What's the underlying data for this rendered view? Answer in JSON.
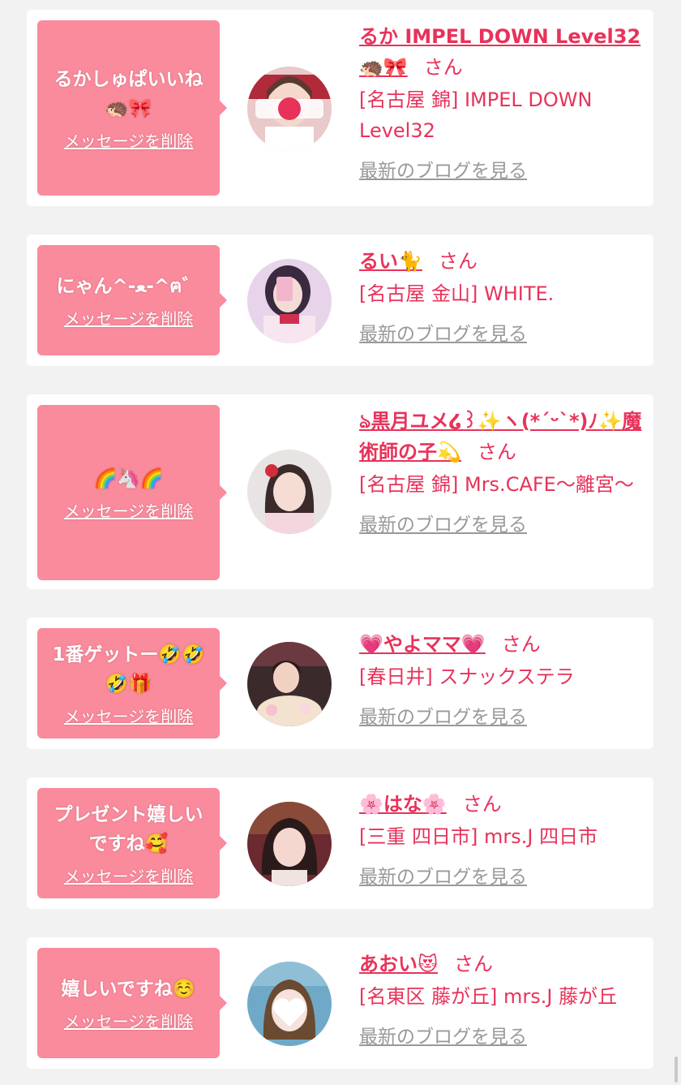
{
  "delete_label": "メッセージを削除",
  "san_label": "さん",
  "blog_label": "最新のブログを見る",
  "colors": {
    "accent": "#e8325a",
    "bubble": "#f98b9c",
    "link_gray": "#999999"
  },
  "cards": [
    {
      "message": "るかしゅぱいいね🦔🎀",
      "name": "るか IMPEL DOWN Level32🦔🎀",
      "shop": "[名古屋 錦] IMPEL DOWN Level32"
    },
    {
      "message": "にゃん^-ﻌ-^ฅ゛",
      "name": "るい🐈",
      "shop": "[名古屋 金山] WHITE."
    },
    {
      "message": "🌈🦄🌈",
      "name": "ঌ黒月ユメ໒꒱✨ヽ(*ˊᵕˋ*)ﾉ✨魔術師の子💫",
      "shop": "[名古屋 錦] Mrs.CAFE〜離宮〜"
    },
    {
      "message": "1番ゲットー🤣🤣🤣🎁",
      "name": "💗やよママ💗",
      "shop": "[春日井] スナックステラ"
    },
    {
      "message": "プレゼント嬉しいですね🥰",
      "name": "🌸はな🌸",
      "shop": "[三重 四日市] mrs.J 四日市"
    },
    {
      "message": "嬉しいですね☺️",
      "name": "あおい😻",
      "shop": "[名東区 藤が丘] mrs.J 藤が丘"
    }
  ]
}
